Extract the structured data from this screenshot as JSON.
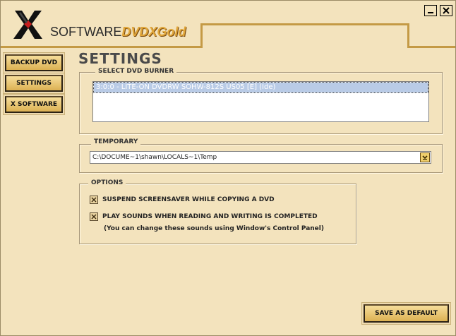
{
  "header": {
    "logo_prefix": "SOFTWARE",
    "logo_brand": "DVDXGold"
  },
  "window": {
    "minimize_icon": "minimize-icon",
    "close_icon": "close-icon"
  },
  "nav": {
    "items": [
      {
        "label": "BACKUP DVD"
      },
      {
        "label": "SETTINGS"
      },
      {
        "label": "X SOFTWARE"
      }
    ]
  },
  "page": {
    "title": "SETTINGS"
  },
  "burner": {
    "legend": "SELECT DVD BURNER",
    "items": [
      "3:0:0 - LITE-ON DVDRW SOHW-812S US05 [E] (Ide)"
    ]
  },
  "temporary": {
    "legend": "TEMPORARY",
    "value": "C:\\DOCUME~1\\shawn\\LOCALS~1\\Temp"
  },
  "options": {
    "legend": "OPTIONS",
    "suspend_label": "SUSPEND SCREENSAVER WHILE COPYING A DVD",
    "suspend_checked": true,
    "sounds_label": "PLAY SOUNDS WHEN READING AND WRITING IS COMPLETED",
    "sounds_checked": true,
    "note": "(You can change these sounds using Window's Control Panel)"
  },
  "actions": {
    "save_default": "SAVE AS DEFAULT"
  },
  "colors": {
    "background": "#f3e3bd",
    "accent": "#c49a45",
    "button": "#dcb152",
    "selection": "#b9cbe6"
  }
}
